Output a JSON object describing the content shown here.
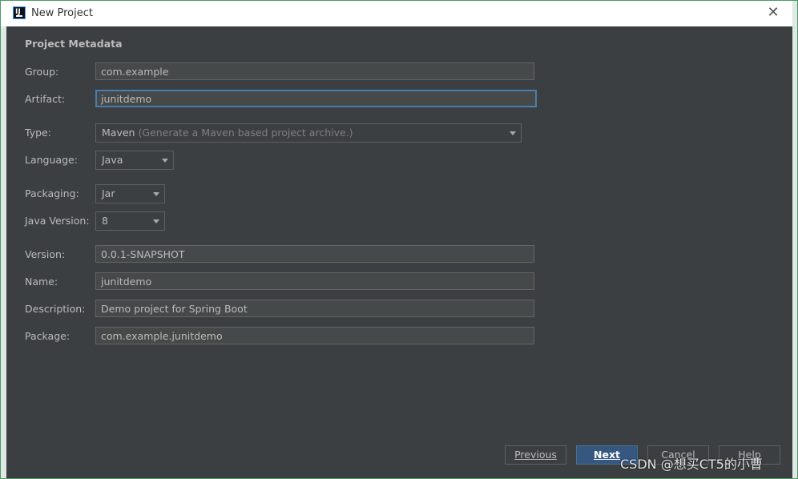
{
  "window": {
    "title": "New Project",
    "app_icon_label": "IJ"
  },
  "section_title": "Project Metadata",
  "fields": {
    "group": {
      "label": "Group:",
      "value": "com.example"
    },
    "artifact": {
      "label": "Artifact:",
      "value": "junitdemo"
    },
    "type": {
      "label": "Type:",
      "value": "Maven",
      "hint": "(Generate a Maven based project archive.)"
    },
    "language": {
      "label": "Language:",
      "value": "Java"
    },
    "packaging": {
      "label": "Packaging:",
      "value": "Jar"
    },
    "java_version": {
      "label": "Java Version:",
      "value": "8"
    },
    "version": {
      "label": "Version:",
      "value": "0.0.1-SNAPSHOT"
    },
    "name": {
      "label": "Name:",
      "value": "junitdemo"
    },
    "description": {
      "label": "Description:",
      "value": "Demo project for Spring Boot"
    },
    "package": {
      "label": "Package:",
      "value": "com.example.junitdemo"
    }
  },
  "buttons": {
    "previous": "Previous",
    "next": "Next",
    "cancel": "Cancel",
    "help": "Help"
  },
  "watermark": "CSDN @想买CT5的小曹",
  "colors": {
    "background": "#3c3f41",
    "field_bg": "#45494a",
    "focus_border": "#4a7eaa",
    "primary_button": "#365880",
    "window_border": "#4a9a6a"
  },
  "icons": {
    "close": "close-icon",
    "dropdown": "chevron-down-icon"
  }
}
